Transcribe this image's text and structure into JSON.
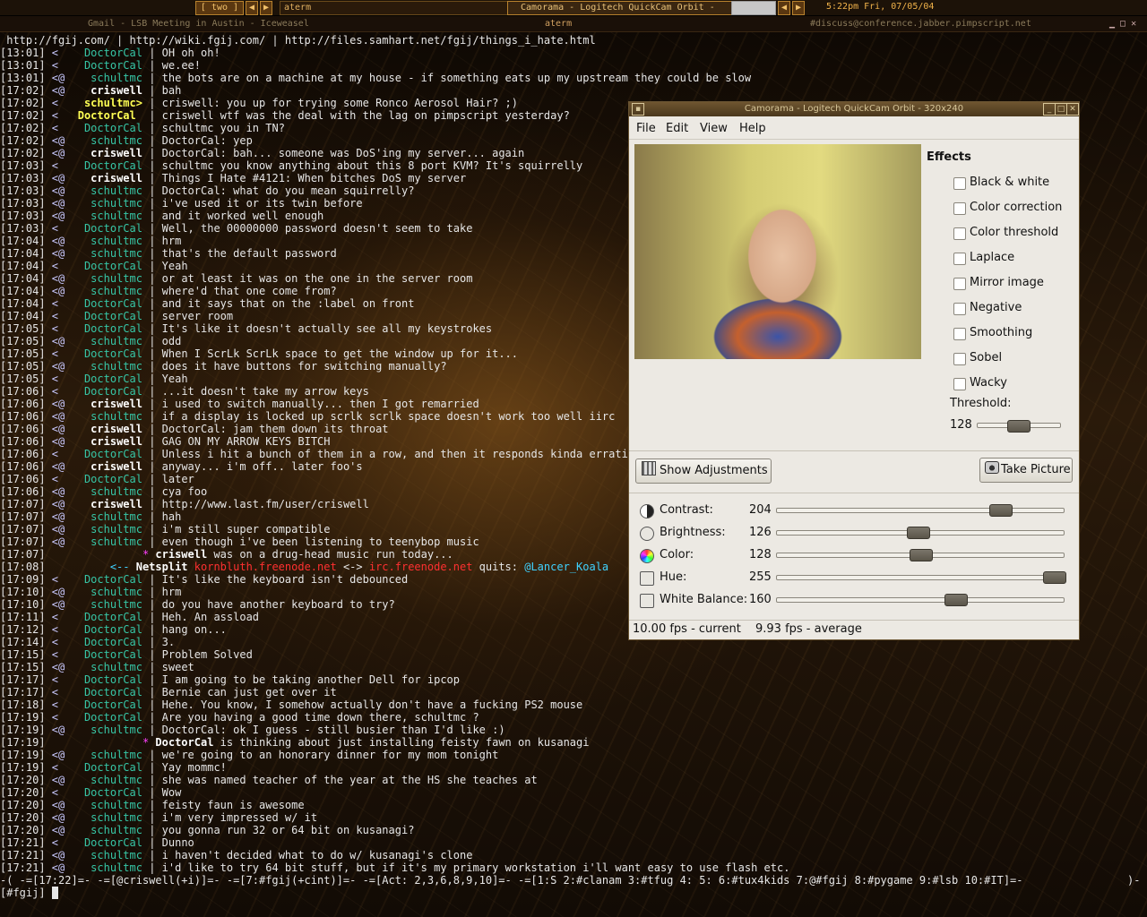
{
  "panel": {
    "workspace": "[ two ]",
    "terminal_task": "aterm",
    "camorama_task": "Camorama - Logitech QuickCam Orbit -",
    "clock": "5:22pm Fri, 07/05/04"
  },
  "title_bar": {
    "left": "Gmail - LSB Meeting in Austin - Iceweasel",
    "center": "aterm",
    "right": "#discuss@conference.jabber.pimpscript.net"
  },
  "terminal": {
    "topic": " http://fgij.com/ | http://wiki.fgij.com/ | http://files.samhart.net/fgij/things_i_hate.html",
    "lines": [
      {
        "ts": "[13:01]",
        "mode": " < ",
        "nick": "   DoctorCal",
        "nc": "dc",
        "msg": "OH oh oh!"
      },
      {
        "ts": "[13:01]",
        "mode": " < ",
        "nick": "   DoctorCal",
        "nc": "dc",
        "msg": "we.ee!"
      },
      {
        "ts": "[13:01]",
        "mode": " <@",
        "nick": "    schultmc",
        "nc": "sc",
        "msg": "the bots are on a machine at my house - if something eats up my upstream they could be slow"
      },
      {
        "ts": "[17:02]",
        "mode": " <@",
        "nick": "    criswell",
        "nc": "cr",
        "msg": "bah"
      },
      {
        "ts": "[17:02]",
        "mode": " < ",
        "nick": "   schultmc>",
        "nc": "me",
        "msg": "criswell: you up for trying some Ronco Aerosol Hair? ;)"
      },
      {
        "ts": "[17:02]",
        "mode": " < ",
        "nick": "  DoctorCal ",
        "nc": "me",
        "msg": "criswell wtf was the deal with the lag on pimpscript yesterday?"
      },
      {
        "ts": "[17:02]",
        "mode": " < ",
        "nick": "   DoctorCal",
        "nc": "dc",
        "msg": "schultmc you in TN?"
      },
      {
        "ts": "[17:02]",
        "mode": " <@",
        "nick": "    schultmc",
        "nc": "sc",
        "msg": "DoctorCal: yep"
      },
      {
        "ts": "[17:02]",
        "mode": " <@",
        "nick": "    criswell",
        "nc": "cr",
        "msg": "DoctorCal: bah... someone was DoS'ing my server... again"
      },
      {
        "ts": "[17:03]",
        "mode": " < ",
        "nick": "   DoctorCal",
        "nc": "dc",
        "msg": "schultmc you know anything about this 8 port KVM? It's squirrelly"
      },
      {
        "ts": "[17:03]",
        "mode": " <@",
        "nick": "    criswell",
        "nc": "cr",
        "msg": "Things I Hate #4121: When bitches DoS my server"
      },
      {
        "ts": "[17:03]",
        "mode": " <@",
        "nick": "    schultmc",
        "nc": "sc",
        "msg": "DoctorCal: what do you mean squirrelly?"
      },
      {
        "ts": "[17:03]",
        "mode": " <@",
        "nick": "    schultmc",
        "nc": "sc",
        "msg": "i've used it or its twin before"
      },
      {
        "ts": "[17:03]",
        "mode": " <@",
        "nick": "    schultmc",
        "nc": "sc",
        "msg": "and it worked well enough"
      },
      {
        "ts": "[17:03]",
        "mode": " < ",
        "nick": "   DoctorCal",
        "nc": "dc",
        "msg": "Well, the 00000000 password doesn't seem to take"
      },
      {
        "ts": "[17:04]",
        "mode": " <@",
        "nick": "    schultmc",
        "nc": "sc",
        "msg": "hrm"
      },
      {
        "ts": "[17:04]",
        "mode": " <@",
        "nick": "    schultmc",
        "nc": "sc",
        "msg": "that's the default password"
      },
      {
        "ts": "[17:04]",
        "mode": " < ",
        "nick": "   DoctorCal",
        "nc": "dc",
        "msg": "Yeah"
      },
      {
        "ts": "[17:04]",
        "mode": " <@",
        "nick": "    schultmc",
        "nc": "sc",
        "msg": "or at least it was on the one in the server room"
      },
      {
        "ts": "[17:04]",
        "mode": " <@",
        "nick": "    schultmc",
        "nc": "sc",
        "msg": "where'd that one come from?"
      },
      {
        "ts": "[17:04]",
        "mode": " < ",
        "nick": "   DoctorCal",
        "nc": "dc",
        "msg": "and it says that on the :label on front"
      },
      {
        "ts": "[17:04]",
        "mode": " < ",
        "nick": "   DoctorCal",
        "nc": "dc",
        "msg": "server room"
      },
      {
        "ts": "[17:05]",
        "mode": " < ",
        "nick": "   DoctorCal",
        "nc": "dc",
        "msg": "It's like it doesn't actually see all my keystrokes"
      },
      {
        "ts": "[17:05]",
        "mode": " <@",
        "nick": "    schultmc",
        "nc": "sc",
        "msg": "odd"
      },
      {
        "ts": "[17:05]",
        "mode": " < ",
        "nick": "   DoctorCal",
        "nc": "dc",
        "msg": "When I ScrLk ScrLk space to get the window up for it..."
      },
      {
        "ts": "[17:05]",
        "mode": " <@",
        "nick": "    schultmc",
        "nc": "sc",
        "msg": "does it have buttons for switching manually?"
      },
      {
        "ts": "[17:05]",
        "mode": " < ",
        "nick": "   DoctorCal",
        "nc": "dc",
        "msg": "Yeah"
      },
      {
        "ts": "[17:06]",
        "mode": " < ",
        "nick": "   DoctorCal",
        "nc": "dc",
        "msg": "...it doesn't take my arrow keys"
      },
      {
        "ts": "[17:06]",
        "mode": " <@",
        "nick": "    criswell",
        "nc": "cr",
        "msg": "i used to switch manually... then I got remarried"
      },
      {
        "ts": "[17:06]",
        "mode": " <@",
        "nick": "    schultmc",
        "nc": "sc",
        "msg": "if a display is locked up scrlk scrlk space doesn't work too well iirc"
      },
      {
        "ts": "[17:06]",
        "mode": " <@",
        "nick": "    criswell",
        "nc": "cr",
        "msg": "DoctorCal: jam them down its throat"
      },
      {
        "ts": "[17:06]",
        "mode": " <@",
        "nick": "    criswell",
        "nc": "cr",
        "msg": "GAG ON MY ARROW KEYS BITCH"
      },
      {
        "ts": "[17:06]",
        "mode": " < ",
        "nick": "   DoctorCal",
        "nc": "dc",
        "msg": "Unless i hit a bunch of them in a row, and then it responds kinda erratic"
      },
      {
        "ts": "[17:06]",
        "mode": " <@",
        "nick": "    criswell",
        "nc": "cr",
        "msg": "anyway... i'm off.. later foo's"
      },
      {
        "ts": "[17:06]",
        "mode": " < ",
        "nick": "   DoctorCal",
        "nc": "dc",
        "msg": "later"
      },
      {
        "ts": "[17:06]",
        "mode": " <@",
        "nick": "    schultmc",
        "nc": "sc",
        "msg": "cya foo"
      },
      {
        "ts": "[17:07]",
        "mode": " <@",
        "nick": "    criswell",
        "nc": "cr",
        "msg": "http://www.last.fm/user/criswell"
      },
      {
        "ts": "[17:07]",
        "mode": " <@",
        "nick": "    schultmc",
        "nc": "sc",
        "msg": "hah"
      },
      {
        "ts": "[17:07]",
        "mode": " <@",
        "nick": "    schultmc",
        "nc": "sc",
        "msg": "i'm still super compatible"
      },
      {
        "ts": "[17:07]",
        "mode": " <@",
        "nick": "    schultmc",
        "nc": "sc",
        "msg": "even though i've been listening to teenybop music"
      },
      {
        "ts": "[17:07]",
        "kind": "action",
        "pre": "               * ",
        "nick": "criswell",
        "msg": " was on a drug-head music run today..."
      },
      {
        "ts": "[17:08]",
        "kind": "netsplit",
        "pre": "          <-- ",
        "word": "Netsplit",
        "a": "kornbluth.freenode.net",
        "mid": " <-> ",
        "b": "irc.freenode.net",
        "tail": " quits: ",
        "who": "@Lancer_Koala"
      },
      {
        "ts": "[17:09]",
        "mode": " < ",
        "nick": "   DoctorCal",
        "nc": "dc",
        "msg": "It's like the keyboard isn't debounced"
      },
      {
        "ts": "[17:10]",
        "mode": " <@",
        "nick": "    schultmc",
        "nc": "sc",
        "msg": "hrm"
      },
      {
        "ts": "[17:10]",
        "mode": " <@",
        "nick": "    schultmc",
        "nc": "sc",
        "msg": "do you have another keyboard to try?"
      },
      {
        "ts": "[17:11]",
        "mode": " < ",
        "nick": "   DoctorCal",
        "nc": "dc",
        "msg": "Heh. An assload"
      },
      {
        "ts": "[17:12]",
        "mode": " < ",
        "nick": "   DoctorCal",
        "nc": "dc",
        "msg": "hang on..."
      },
      {
        "ts": "[17:14]",
        "mode": " < ",
        "nick": "   DoctorCal",
        "nc": "dc",
        "msg": "3."
      },
      {
        "ts": "[17:15]",
        "mode": " < ",
        "nick": "   DoctorCal",
        "nc": "dc",
        "msg": "Problem Solved"
      },
      {
        "ts": "[17:15]",
        "mode": " <@",
        "nick": "    schultmc",
        "nc": "sc",
        "msg": "sweet"
      },
      {
        "ts": "[17:17]",
        "mode": " < ",
        "nick": "   DoctorCal",
        "nc": "dc",
        "msg": "I am going to be taking another Dell for ipcop"
      },
      {
        "ts": "[17:17]",
        "mode": " < ",
        "nick": "   DoctorCal",
        "nc": "dc",
        "msg": "Bernie can just get over it"
      },
      {
        "ts": "[17:18]",
        "mode": " < ",
        "nick": "   DoctorCal",
        "nc": "dc",
        "msg": "Hehe. You know, I somehow actually don't have a fucking PS2 mouse"
      },
      {
        "ts": "[17:19]",
        "mode": " < ",
        "nick": "   DoctorCal",
        "nc": "dc",
        "msg": "Are you having a good time down there, schultmc ?"
      },
      {
        "ts": "[17:19]",
        "mode": " <@",
        "nick": "    schultmc",
        "nc": "sc",
        "msg": "DoctorCal: ok I guess - still busier than I'd like :)"
      },
      {
        "ts": "[17:19]",
        "kind": "action",
        "pre": "               * ",
        "nick": "DoctorCal",
        "msg": " is thinking about just installing feisty fawn on kusanagi"
      },
      {
        "ts": "[17:19]",
        "mode": " <@",
        "nick": "    schultmc",
        "nc": "sc",
        "msg": "we're going to an honorary dinner for my mom tonight"
      },
      {
        "ts": "[17:19]",
        "mode": " < ",
        "nick": "   DoctorCal",
        "nc": "dc",
        "msg": "Yay mommc!"
      },
      {
        "ts": "[17:20]",
        "mode": " <@",
        "nick": "    schultmc",
        "nc": "sc",
        "msg": "she was named teacher of the year at the HS she teaches at"
      },
      {
        "ts": "[17:20]",
        "mode": " < ",
        "nick": "   DoctorCal",
        "nc": "dc",
        "msg": "Wow"
      },
      {
        "ts": "[17:20]",
        "mode": " <@",
        "nick": "    schultmc",
        "nc": "sc",
        "msg": "feisty faun is awesome"
      },
      {
        "ts": "[17:20]",
        "mode": " <@",
        "nick": "    schultmc",
        "nc": "sc",
        "msg": "i'm very impressed w/ it"
      },
      {
        "ts": "[17:20]",
        "mode": " <@",
        "nick": "    schultmc",
        "nc": "sc",
        "msg": "you gonna run 32 or 64 bit on kusanagi?"
      },
      {
        "ts": "[17:21]",
        "mode": " < ",
        "nick": "   DoctorCal",
        "nc": "dc",
        "msg": "Dunno"
      },
      {
        "ts": "[17:21]",
        "mode": " <@",
        "nick": "    schultmc",
        "nc": "sc",
        "msg": "i haven't decided what to do w/ kusanagi's clone"
      },
      {
        "ts": "[17:21]",
        "mode": " <@",
        "nick": "    schultmc",
        "nc": "sc",
        "msg": "i'd like to try 64 bit stuff, but if it's my primary workstation i'll want easy to use flash etc."
      }
    ],
    "status_line": "-( -=[17:22]=- -=[@criswell(+i)]=- -=[7:#fgij(+cint)]=- -=[Act: 2,3,6,8,9,10]=- -=[1:S 2:#clanam 3:#tfug 4: 5: 6:#tux4kids 7:@#fgij 8:#pygame 9:#lsb 10:#IT]=-",
    "status_end": ")-",
    "input_prompt": "[#fgij] "
  },
  "camorama": {
    "title": "Camorama - Logitech QuickCam Orbit - 320x240",
    "menus": [
      "File",
      "Edit",
      "View",
      "Help"
    ],
    "effects_title": "Effects",
    "effects": [
      "Black & white",
      "Color correction",
      "Color threshold",
      "Laplace",
      "Mirror image",
      "Negative",
      "Smoothing",
      "Sobel",
      "Wacky"
    ],
    "threshold_label": "Threshold:",
    "threshold_value": "128",
    "threshold_level": 0.5,
    "show_adjustments": "Show Adjustments",
    "take_picture": "Take Picture",
    "adjustments": [
      {
        "label": "Contrast:",
        "value": "204",
        "level": 0.8,
        "icon": "contrast-icon"
      },
      {
        "label": "Brightness:",
        "value": "126",
        "level": 0.49,
        "icon": "brightness-icon"
      },
      {
        "label": "Color:",
        "value": "128",
        "level": 0.5,
        "icon": "color-icon"
      },
      {
        "label": "Hue:",
        "value": "255",
        "level": 1.0,
        "icon": "hue-icon"
      },
      {
        "label": "White Balance:",
        "value": "160",
        "level": 0.63,
        "icon": "white-balance-icon"
      }
    ],
    "fps_current": "10.00 fps - current",
    "fps_average": "9.93 fps - average"
  }
}
